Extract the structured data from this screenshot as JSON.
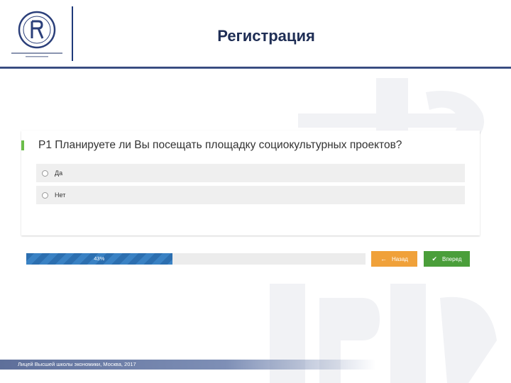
{
  "header": {
    "title": "Регистрация"
  },
  "survey": {
    "question": "Р1 Планируете ли Вы посещать площадку социокультурных проектов?",
    "options": [
      "Да",
      "Нет"
    ]
  },
  "progress": {
    "percent": 43,
    "label": "43%"
  },
  "buttons": {
    "back_label": "Назад",
    "next_label": "Вперед"
  },
  "footer": {
    "text": "Лицей Высшей школы экономики, Москва, 2017"
  },
  "colors": {
    "brand_navy": "#1f2e55",
    "accent_green": "#6bbd4a",
    "progress_blue": "#2c6fb0",
    "back_orange": "#f0a13a",
    "next_green": "#4a9e3a"
  }
}
